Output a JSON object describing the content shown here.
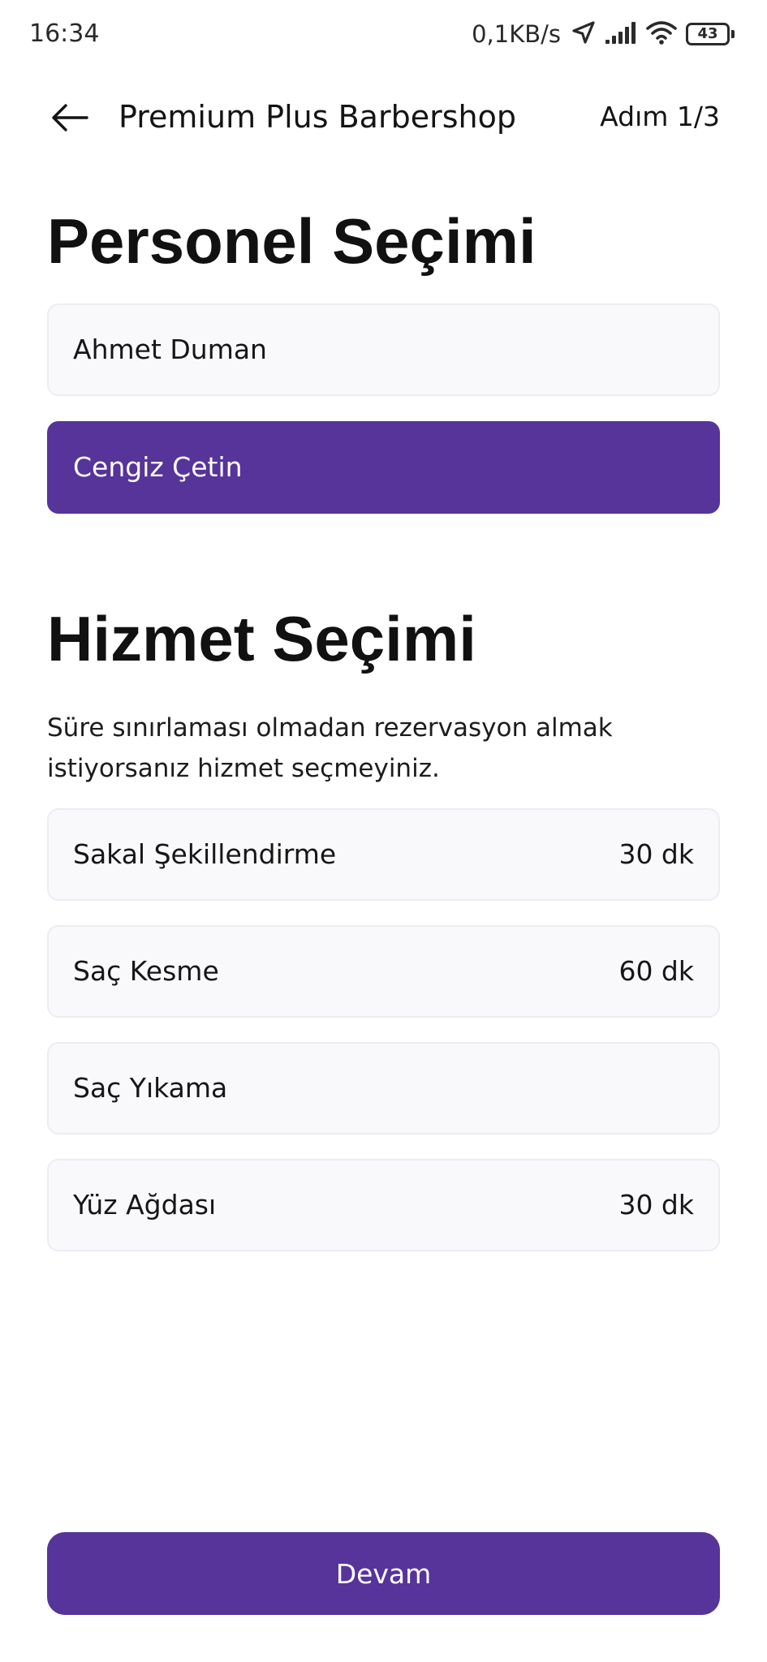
{
  "status_bar": {
    "time": "16:34",
    "net_speed": "0,1KB/s",
    "battery": "43"
  },
  "header": {
    "title": "Premium Plus Barbershop",
    "step": "Adım 1/3"
  },
  "staff": {
    "title": "Personel Seçimi",
    "options": [
      {
        "label": "Ahmet Duman",
        "selected": false
      },
      {
        "label": "Cengiz Çetin",
        "selected": true
      }
    ]
  },
  "service": {
    "title": "Hizmet Seçimi",
    "note": "Süre sınırlaması olmadan rezervasyon almak istiyorsanız hizmet seçmeyiniz.",
    "options": [
      {
        "label": "Sakal Şekillendirme",
        "duration": "30 dk"
      },
      {
        "label": "Saç Kesme",
        "duration": "60 dk"
      },
      {
        "label": "Saç Yıkama",
        "duration": ""
      },
      {
        "label": "Yüz Ağdası",
        "duration": "30 dk"
      }
    ]
  },
  "footer": {
    "continue_label": "Devam"
  },
  "colors": {
    "accent": "#56349a",
    "option_background": "#f9f9fc",
    "option_border": "#ececf2"
  }
}
